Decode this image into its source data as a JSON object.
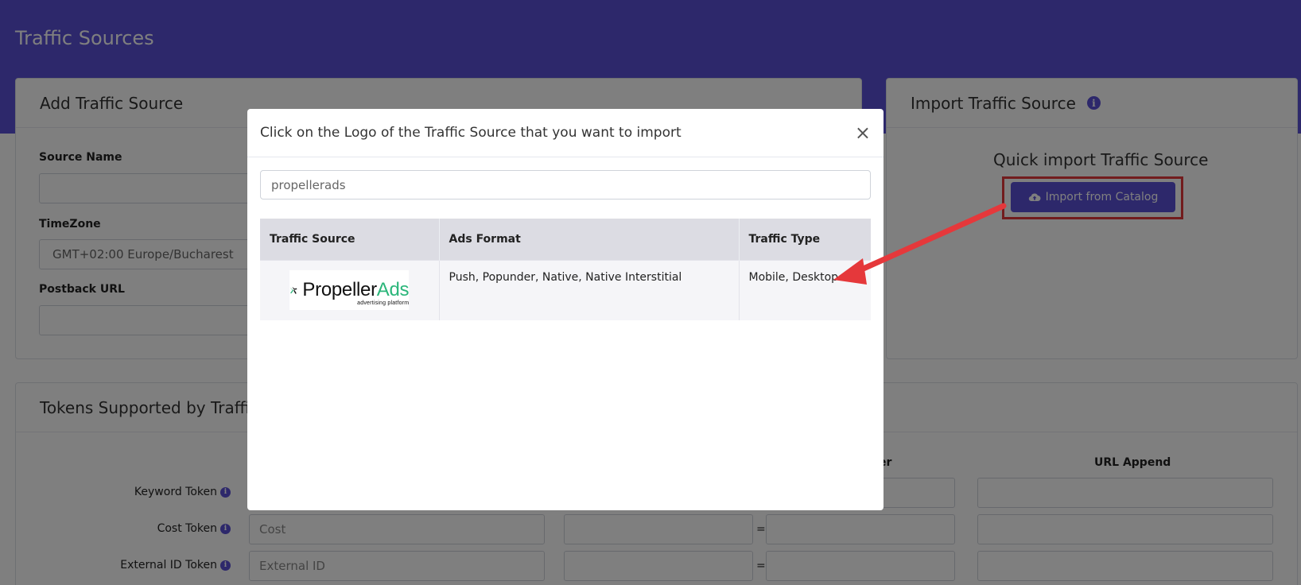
{
  "page": {
    "title": "Traffic Sources"
  },
  "add_card": {
    "title": "Add Traffic Source",
    "source_name_label": "Source Name",
    "timezone_label": "TimeZone",
    "timezone_value": "GMT+02:00 Europe/Bucharest",
    "postback_label": "Postback URL"
  },
  "import_card": {
    "title": "Import Traffic Source",
    "info_icon": "info-icon",
    "quick_title": "Quick import Traffic Source",
    "button_label": "Import from Catalog",
    "button_icon": "cloud-upload-icon"
  },
  "tokens_card": {
    "title": "Tokens Supported by Traffic",
    "col_partial": "er",
    "col_url_append": "URL Append",
    "rows": [
      {
        "label": "Keyword Token",
        "placeholder": ""
      },
      {
        "label": "Cost Token",
        "placeholder": "Cost"
      },
      {
        "label": "External ID Token",
        "placeholder": "External ID"
      }
    ],
    "equals": "="
  },
  "modal": {
    "title": "Click on the Logo of the Traffic Source that you want to import",
    "close": "×",
    "search_value": "propellerads",
    "columns": [
      "Traffic Source",
      "Ads Format",
      "Traffic Type"
    ],
    "rows": [
      {
        "logo_text_a": "Propeller",
        "logo_text_b": "Ads",
        "logo_sub": "advertising platform",
        "ads_format": "Push, Popunder, Native, Native Interstitial",
        "traffic_type": "Mobile, Desktop"
      }
    ]
  },
  "colors": {
    "brand": "#5b50d6",
    "annotation_red": "#e5383b",
    "logo_green": "#2bb67a"
  }
}
